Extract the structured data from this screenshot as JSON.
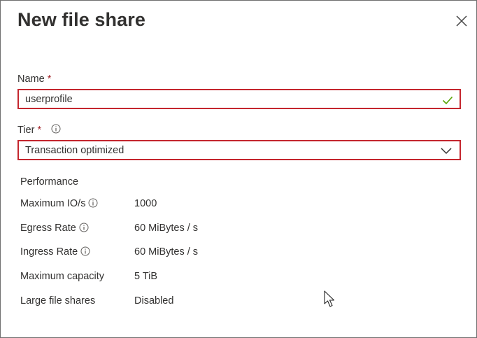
{
  "dialog": {
    "title": "New file share"
  },
  "name_field": {
    "label": "Name",
    "required_mark": "*",
    "value": "userprofile"
  },
  "tier_field": {
    "label": "Tier",
    "required_mark": "*",
    "selected": "Transaction optimized"
  },
  "performance": {
    "heading": "Performance",
    "rows": [
      {
        "label": "Maximum IO/s",
        "value": "1000",
        "has_info": true
      },
      {
        "label": "Egress Rate",
        "value": "60 MiBytes / s",
        "has_info": true
      },
      {
        "label": "Ingress Rate",
        "value": "60 MiBytes / s",
        "has_info": true
      },
      {
        "label": "Maximum capacity",
        "value": "5 TiB",
        "has_info": false
      },
      {
        "label": "Large file shares",
        "value": "Disabled",
        "has_info": false
      }
    ]
  },
  "colors": {
    "highlight_border": "#c4262e",
    "required": "#a4262c",
    "valid_check": "#57a300",
    "text": "#323130"
  },
  "icons": {
    "close": "close-icon",
    "info": "info-icon",
    "check": "checkmark-icon",
    "dropdown": "chevron-down-icon",
    "pointer": "mouse-pointer-icon"
  }
}
